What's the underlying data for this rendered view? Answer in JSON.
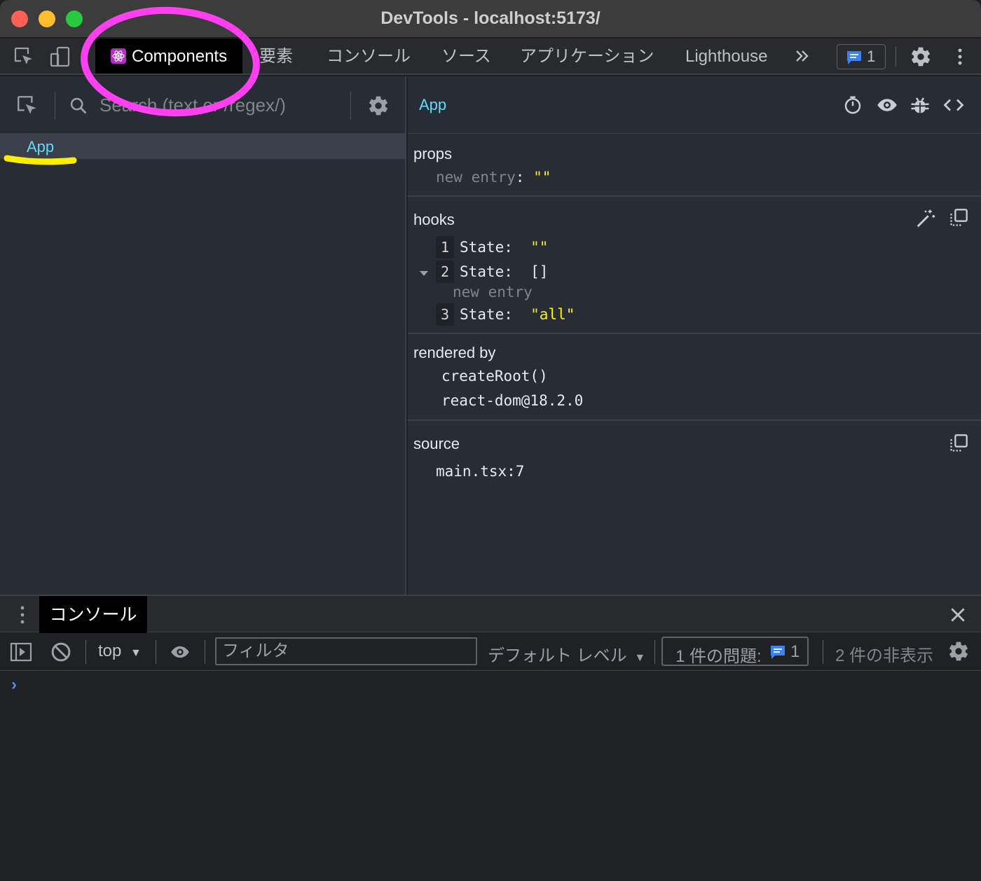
{
  "window": {
    "title": "DevTools - localhost:5173/"
  },
  "tabs": [
    {
      "label": "Components",
      "active": true
    },
    {
      "label": "要素"
    },
    {
      "label": "コンソール"
    },
    {
      "label": "ソース"
    },
    {
      "label": "アプリケーション"
    },
    {
      "label": "Lighthouse"
    }
  ],
  "issues_count": "1",
  "left": {
    "search_placeholder": "Search (text or /regex/)",
    "tree": [
      {
        "label": "App"
      }
    ]
  },
  "inspector": {
    "component": "App",
    "props": {
      "title": "props",
      "entries": [
        {
          "key": "new entry",
          "value": "\"\""
        }
      ]
    },
    "hooks": {
      "title": "hooks",
      "items": [
        {
          "id": "1",
          "label": "State:",
          "value": "\"\""
        },
        {
          "id": "2",
          "label": "State:",
          "value": "[]",
          "child": "new entry"
        },
        {
          "id": "3",
          "label": "State:",
          "value": "\"all\""
        }
      ]
    },
    "rendered_by": {
      "title": "rendered by",
      "items": [
        "createRoot()",
        "react-dom@18.2.0"
      ]
    },
    "source": {
      "title": "source",
      "file": "main.tsx:7"
    }
  },
  "drawer": {
    "tab": "コンソール",
    "context": "top",
    "filter_placeholder": "フィルタ",
    "level": "デフォルト レベル",
    "issues_label": "1 件の問題:",
    "issues_count": "1",
    "hidden_label": "2 件の非表示"
  },
  "colors": {
    "annotation_circle": "#ff3ff0",
    "annotation_underline": "#ffee00",
    "component_name": "#61dafb"
  }
}
